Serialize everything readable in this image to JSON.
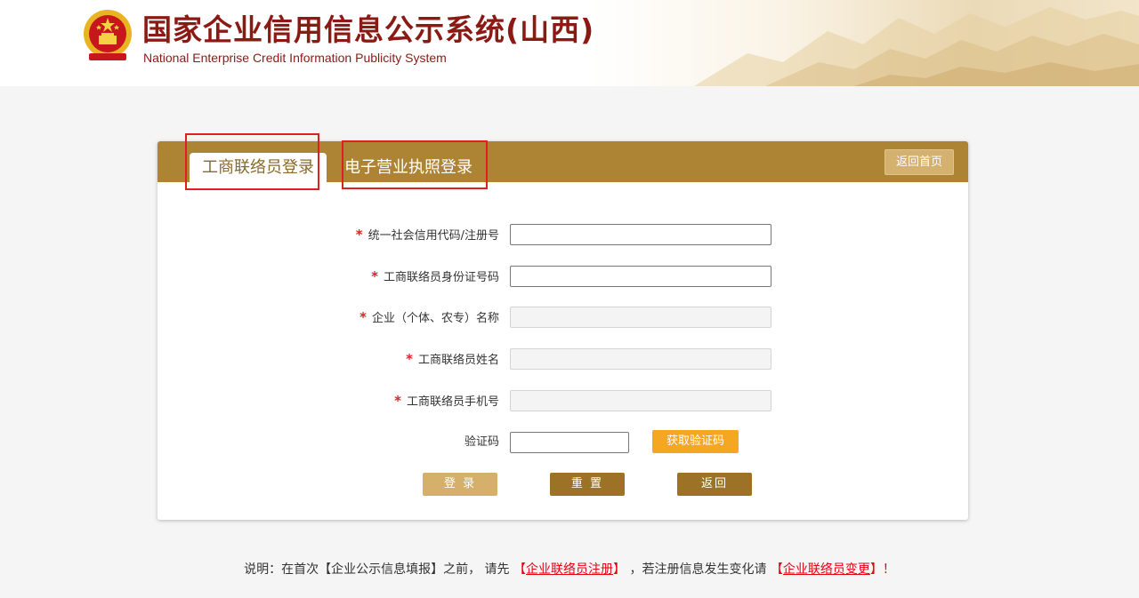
{
  "header": {
    "title": "国家企业信用信息公示系统(山西)",
    "subtitle": "National Enterprise Credit Information Publicity System",
    "emblem_icon": "national-emblem-icon"
  },
  "tabs": [
    {
      "label": "工商联络员登录",
      "active": true
    },
    {
      "label": "电子营业执照登录",
      "active": false
    }
  ],
  "back_home_label": "返回首页",
  "form": {
    "fields": [
      {
        "label": "统一社会信用代码/注册号",
        "required": true,
        "value": "",
        "enabled": true
      },
      {
        "label": "工商联络员身份证号码",
        "required": true,
        "value": "",
        "enabled": true
      },
      {
        "label": "企业（个体、农专）名称",
        "required": true,
        "value": "",
        "enabled": false
      },
      {
        "label": "工商联络员姓名",
        "required": true,
        "value": "",
        "enabled": false
      },
      {
        "label": "工商联络员手机号",
        "required": true,
        "value": "",
        "enabled": false
      }
    ],
    "captcha_label": "验证码",
    "captcha_value": "",
    "get_code_label": "获取验证码",
    "required_mark": "*"
  },
  "buttons": {
    "login": "登 录",
    "reset": "重 置",
    "back": "返回"
  },
  "note": {
    "prefix": "说明：在首次【企业公示信息填报】之前， 请先 ",
    "link1_open": "【",
    "link1": "企业联络员注册",
    "link1_close": "】",
    "middle": " ，若注册信息发生变化请 ",
    "link2_open": "【",
    "link2": "企业联络员变更",
    "link2_close": "】",
    "suffix": "！"
  },
  "colors": {
    "brand_red": "#8b1a14",
    "panel_gold": "#ad8434",
    "highlight_red": "#e02020",
    "sms_orange": "#f5a623"
  }
}
